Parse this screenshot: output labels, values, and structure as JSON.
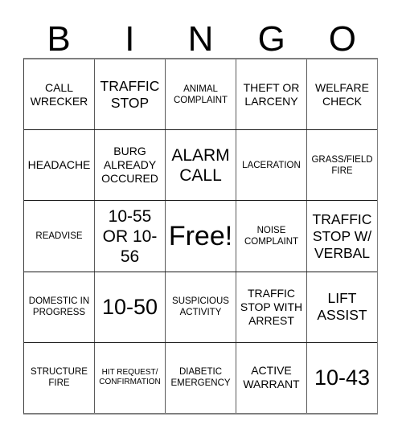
{
  "card": {
    "title_letters": [
      "B",
      "I",
      "N",
      "G",
      "O"
    ],
    "rows": [
      [
        {
          "text": "CALL WRECKER",
          "size": "md"
        },
        {
          "text": "TRAFFIC STOP",
          "size": "lg"
        },
        {
          "text": "ANIMAL COMPLAINT",
          "size": "sm"
        },
        {
          "text": "THEFT OR LARCENY",
          "size": "md"
        },
        {
          "text": "WELFARE CHECK",
          "size": "md"
        }
      ],
      [
        {
          "text": "HEADACHE",
          "size": "md"
        },
        {
          "text": "BURG ALREADY OCCURED",
          "size": "md"
        },
        {
          "text": "ALARM CALL",
          "size": "xl"
        },
        {
          "text": "LACERATION",
          "size": "sm"
        },
        {
          "text": "GRASS/FIELD FIRE",
          "size": "sm"
        }
      ],
      [
        {
          "text": "READVISE",
          "size": "sm"
        },
        {
          "text": "10-55 OR 10-56",
          "size": "xl"
        },
        {
          "text": "Free!",
          "size": "free"
        },
        {
          "text": "NOISE COMPLAINT",
          "size": "sm"
        },
        {
          "text": "TRAFFIC STOP W/ VERBAL",
          "size": "lg"
        }
      ],
      [
        {
          "text": "DOMESTIC IN PROGRESS",
          "size": "sm"
        },
        {
          "text": "10-50",
          "size": "xxl"
        },
        {
          "text": "SUSPICIOUS ACTIVITY",
          "size": "sm"
        },
        {
          "text": "TRAFFIC STOP WITH ARREST",
          "size": "md"
        },
        {
          "text": "LIFT ASSIST",
          "size": "lg"
        }
      ],
      [
        {
          "text": "STRUCTURE FIRE",
          "size": "sm"
        },
        {
          "text": "HIT REQUEST/ CONFIRMATION",
          "size": "xs"
        },
        {
          "text": "DIABETIC EMERGENCY",
          "size": "sm"
        },
        {
          "text": "ACTIVE WARRANT",
          "size": "md"
        },
        {
          "text": "10-43",
          "size": "xxl"
        }
      ]
    ]
  }
}
